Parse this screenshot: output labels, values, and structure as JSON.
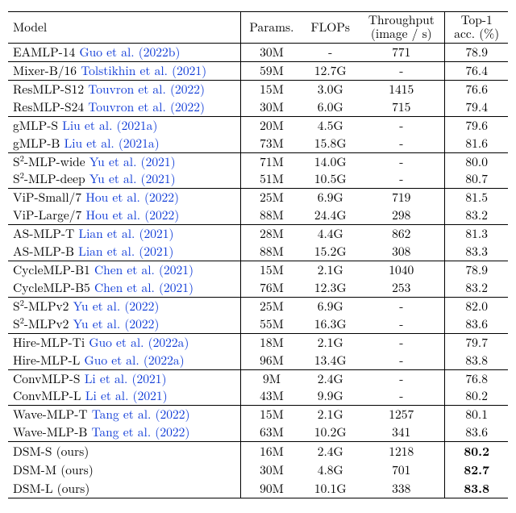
{
  "chart_data": {
    "type": "table",
    "title": "",
    "columns": [
      "Model",
      "Params.",
      "FLOPs",
      "Throughput (image / s)",
      "Top-1 acc. (%)"
    ],
    "rows": [
      {
        "model": "EAMLP-14",
        "cite": "Guo et al. (2022b)",
        "params": "30M",
        "flops": "-",
        "tput": "771",
        "top1": "78.9"
      },
      {
        "model": "Mixer-B/16",
        "cite": "Tolstikhin et al. (2021)",
        "params": "59M",
        "flops": "12.7G",
        "tput": "-",
        "top1": "76.4"
      },
      {
        "model": "ResMLP-S12",
        "cite": "Touvron et al. (2022)",
        "params": "15M",
        "flops": "3.0G",
        "tput": "1415",
        "top1": "76.6"
      },
      {
        "model": "ResMLP-S24",
        "cite": "Touvron et al. (2022)",
        "params": "30M",
        "flops": "6.0G",
        "tput": "715",
        "top1": "79.4"
      },
      {
        "model": "gMLP-S",
        "cite": "Liu et al. (2021a)",
        "params": "20M",
        "flops": "4.5G",
        "tput": "-",
        "top1": "79.6"
      },
      {
        "model": "gMLP-B",
        "cite": "Liu et al. (2021a)",
        "params": "73M",
        "flops": "15.8G",
        "tput": "-",
        "top1": "81.6"
      },
      {
        "model": "S²-MLP-wide",
        "cite": "Yu et al. (2021)",
        "params": "71M",
        "flops": "14.0G",
        "tput": "-",
        "top1": "80.0"
      },
      {
        "model": "S²-MLP-deep",
        "cite": "Yu et al. (2021)",
        "params": "51M",
        "flops": "10.5G",
        "tput": "-",
        "top1": "80.7"
      },
      {
        "model": "ViP-Small/7",
        "cite": "Hou et al. (2022)",
        "params": "25M",
        "flops": "6.9G",
        "tput": "719",
        "top1": "81.5"
      },
      {
        "model": "ViP-Large/7",
        "cite": "Hou et al. (2022)",
        "params": "88M",
        "flops": "24.4G",
        "tput": "298",
        "top1": "83.2"
      },
      {
        "model": "AS-MLP-T",
        "cite": "Lian et al. (2021)",
        "params": "28M",
        "flops": "4.4G",
        "tput": "862",
        "top1": "81.3"
      },
      {
        "model": "AS-MLP-B",
        "cite": "Lian et al. (2021)",
        "params": "88M",
        "flops": "15.2G",
        "tput": "308",
        "top1": "83.3"
      },
      {
        "model": "CycleMLP-B1",
        "cite": "Chen et al. (2021)",
        "params": "15M",
        "flops": "2.1G",
        "tput": "1040",
        "top1": "78.9"
      },
      {
        "model": "CycleMLP-B5",
        "cite": "Chen et al. (2021)",
        "params": "76M",
        "flops": "12.3G",
        "tput": "253",
        "top1": "83.2"
      },
      {
        "model": "S²-MLPv2",
        "cite": "Yu et al. (2022)",
        "params": "25M",
        "flops": "6.9G",
        "tput": "-",
        "top1": "82.0"
      },
      {
        "model": "S²-MLPv2",
        "cite": "Yu et al. (2022)",
        "params": "55M",
        "flops": "16.3G",
        "tput": "-",
        "top1": "83.6"
      },
      {
        "model": "Hire-MLP-Ti",
        "cite": "Guo et al. (2022a)",
        "params": "18M",
        "flops": "2.1G",
        "tput": "-",
        "top1": "79.7"
      },
      {
        "model": "Hire-MLP-L",
        "cite": "Guo et al. (2022a)",
        "params": "96M",
        "flops": "13.4G",
        "tput": "-",
        "top1": "83.8"
      },
      {
        "model": "ConvMLP-S",
        "cite": "Li et al. (2021)",
        "params": "9M",
        "flops": "2.4G",
        "tput": "-",
        "top1": "76.8"
      },
      {
        "model": "ConvMLP-L",
        "cite": "Li et al. (2021)",
        "params": "43M",
        "flops": "9.9G",
        "tput": "-",
        "top1": "80.2"
      },
      {
        "model": "Wave-MLP-T",
        "cite": "Tang et al. (2022)",
        "params": "15M",
        "flops": "2.1G",
        "tput": "1257",
        "top1": "80.1"
      },
      {
        "model": "Wave-MLP-B",
        "cite": "Tang et al. (2022)",
        "params": "63M",
        "flops": "10.2G",
        "tput": "341",
        "top1": "83.6"
      },
      {
        "model": "DSM-S (ours)",
        "cite": "",
        "params": "16M",
        "flops": "2.4G",
        "tput": "1218",
        "top1": "80.2",
        "bold": true
      },
      {
        "model": "DSM-M (ours)",
        "cite": "",
        "params": "30M",
        "flops": "4.8G",
        "tput": "701",
        "top1": "82.7",
        "bold": true
      },
      {
        "model": "DSM-L (ours)",
        "cite": "",
        "params": "90M",
        "flops": "10.1G",
        "tput": "338",
        "top1": "83.8",
        "bold": true
      }
    ],
    "group_breaks_after_index": [
      0,
      1,
      3,
      5,
      7,
      9,
      11,
      13,
      15,
      17,
      19,
      21
    ]
  },
  "header": {
    "col0": "Model",
    "col1": "Params.",
    "col2": "FLOPs",
    "col3a": "Throughput",
    "col3b": "(image / s)",
    "col4a": "Top-1",
    "col4b": "acc. (%)"
  }
}
